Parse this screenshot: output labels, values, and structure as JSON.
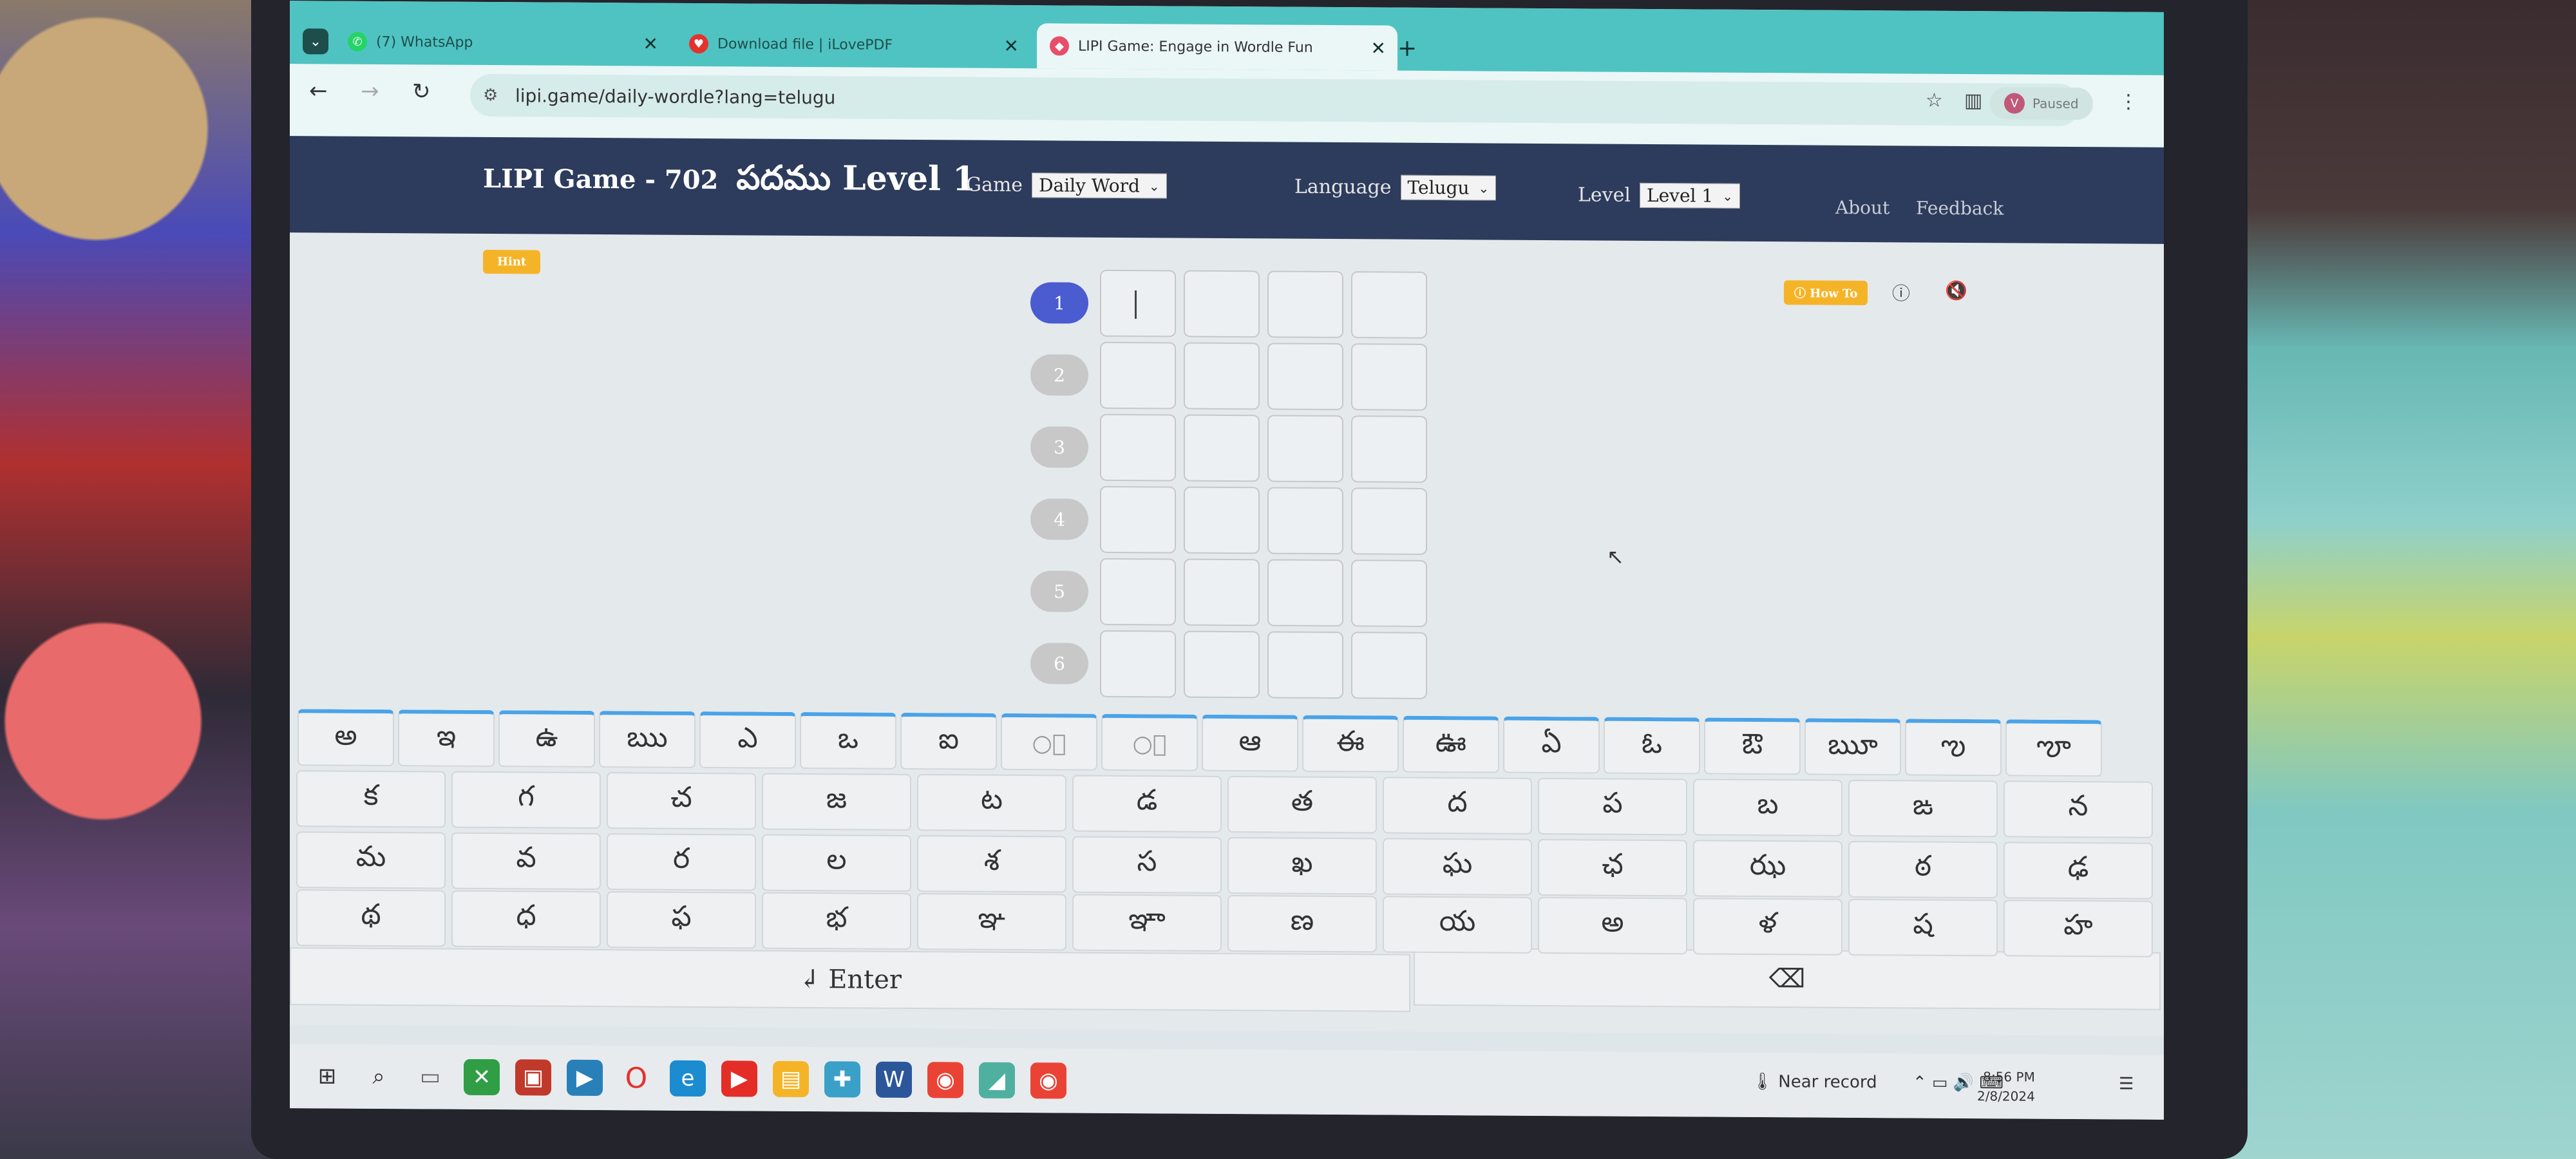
{
  "browser": {
    "tabs": [
      {
        "label": "(7) WhatsApp",
        "icon": "whatsapp-icon",
        "badge": "7"
      },
      {
        "label": "Download file | iLovePDF",
        "icon": "ilovepdf-icon"
      },
      {
        "label": "LIPI Game: Engage in Wordle Fun",
        "icon": "lipi-icon"
      }
    ],
    "new_tab": "+",
    "url": "lipi.game/daily-wordle?lang=telugu",
    "profile_initial": "V",
    "profile_status": "Paused"
  },
  "header": {
    "title": "LIPI Game - 702",
    "title_word": "పదము Level 1",
    "game_label": "Game",
    "game_value": "Daily Word",
    "language_label": "Language",
    "language_value": "Telugu",
    "level_label": "Level",
    "level_value": "Level 1",
    "about": "About",
    "feedback": "Feedback"
  },
  "hint": "Hint",
  "how_to": "How To",
  "board": {
    "rows": [
      "1",
      "2",
      "3",
      "4",
      "5",
      "6"
    ],
    "active_row": 0,
    "columns": 4
  },
  "keyboard": {
    "vowels": [
      "అ",
      "ఇ",
      "ఉ",
      "ఋ",
      "ఎ",
      "ఒ",
      "ఐ",
      "ం",
      "ః",
      "ఆ",
      "ఈ",
      "ఊ",
      "ఏ",
      "ఓ",
      "ఔ",
      "ౠ",
      "ఌ",
      "ౡ"
    ],
    "row1": [
      "క",
      "గ",
      "చ",
      "జ",
      "ట",
      "డ",
      "త",
      "ద",
      "ప",
      "బ",
      "ఙ",
      "న"
    ],
    "row2": [
      "మ",
      "వ",
      "ర",
      "ల",
      "శ",
      "స",
      "ఖ",
      "ఘ",
      "ఛ",
      "ఝ",
      "ఠ",
      "ఢ"
    ],
    "row3": [
      "థ",
      "ధ",
      "ఫ",
      "భ",
      "ఞ",
      "ఞా",
      "ణ",
      "య",
      "అ",
      "ళ",
      "ష",
      "హ"
    ],
    "enter": "↲ Enter",
    "backspace": "⌫"
  },
  "taskbar": {
    "weather": "Near record",
    "time": "8:56 PM",
    "date": "2/8/2024"
  },
  "colors": {
    "tabstrip": "#4fc3c1",
    "header": "#2d3b5c",
    "hint": "#f5b428",
    "active_row": "#4a5ccf"
  }
}
